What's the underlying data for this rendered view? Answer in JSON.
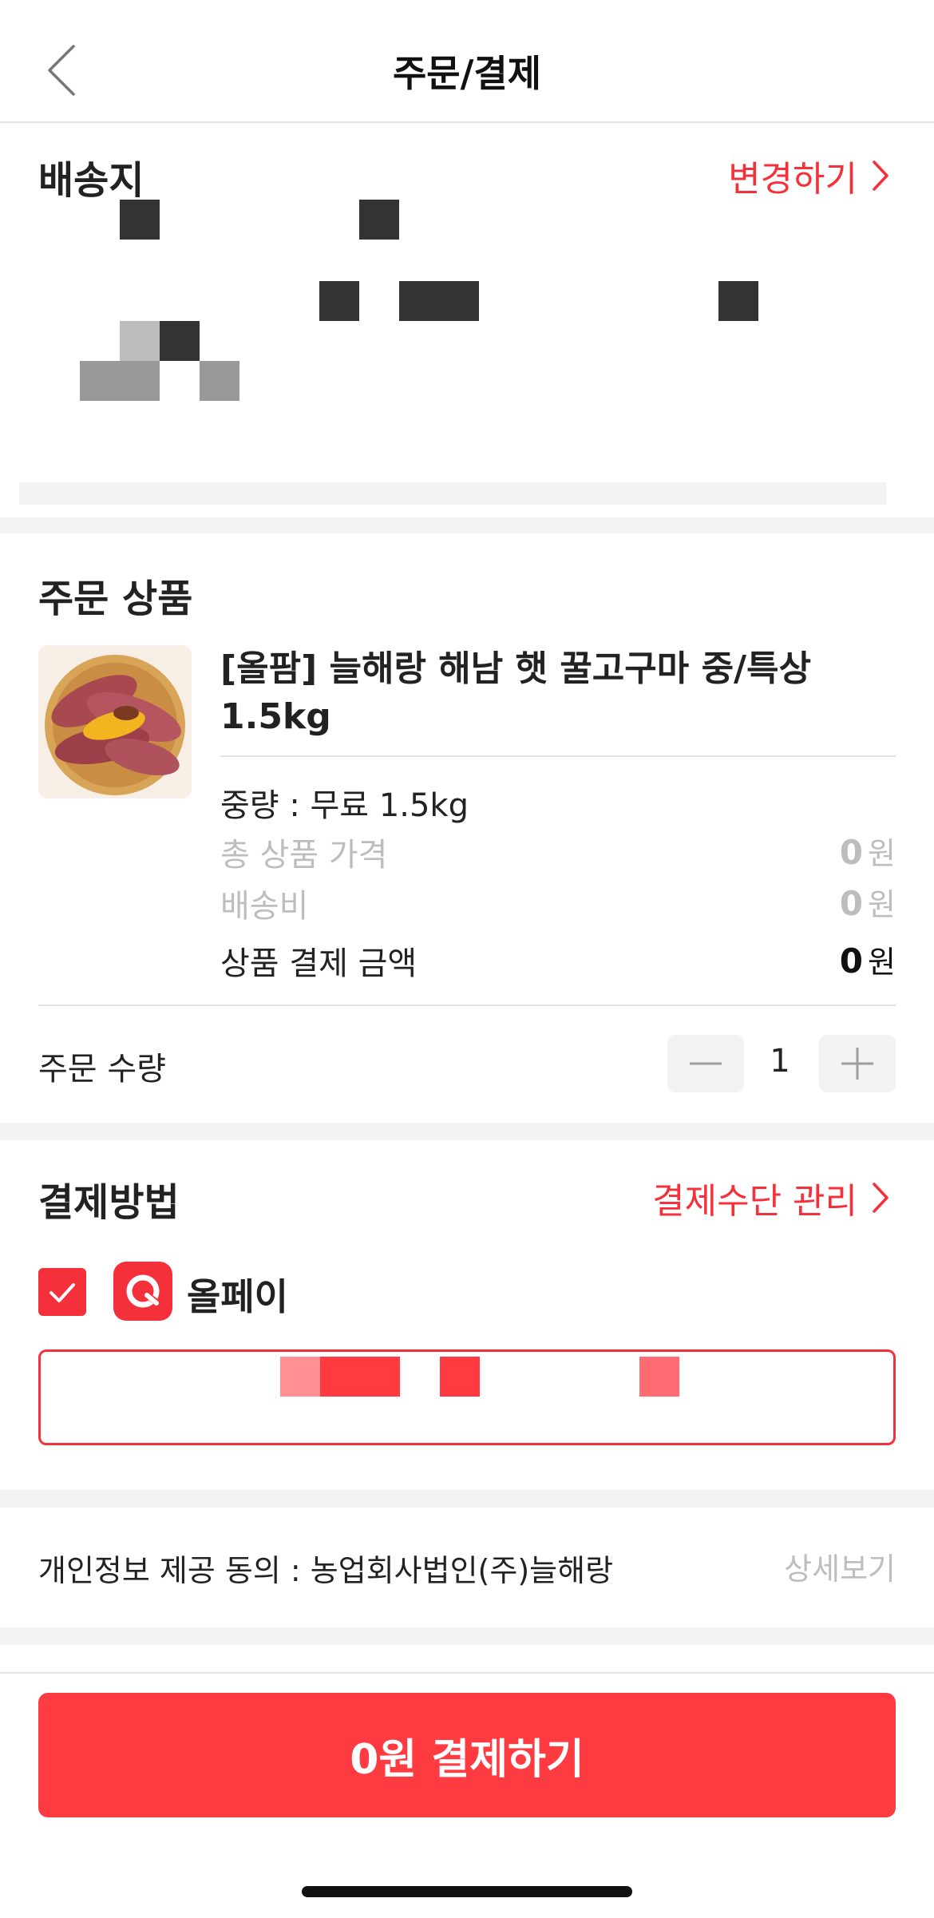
{
  "header": {
    "title": "주문/결제",
    "back_icon": "chevron-left-icon"
  },
  "shipping": {
    "title": "배송지",
    "change_label": "변경하기"
  },
  "order_items": {
    "title": "주문 상품",
    "product": {
      "name": "[올팜] 늘해랑 해남 햇 꿀고구마 중/특상 1.5kg",
      "option": "중량 : 무료 1.5kg",
      "total_price_label": "총 상품 가격",
      "total_price_value": "0",
      "shipping_fee_label": "배송비",
      "shipping_fee_value": "0",
      "payment_amount_label": "상품 결제 금액",
      "payment_amount_value": "0",
      "currency": "원"
    },
    "quantity_label": "주문 수량",
    "quantity_value": "1"
  },
  "payment_method": {
    "title": "결제방법",
    "manage_label": "결제수단 관리",
    "selected_method": "올페이",
    "checked": true
  },
  "privacy": {
    "consent_text": "개인정보 제공 동의 : 농업회사법인(주)늘해랑",
    "detail_label": "상세보기"
  },
  "pay_button_label": "0원 결제하기",
  "colors": {
    "accent": "#f4313b",
    "button": "#fd3b41",
    "muted": "#bdbdbd",
    "divider": "#f3f3f3"
  }
}
